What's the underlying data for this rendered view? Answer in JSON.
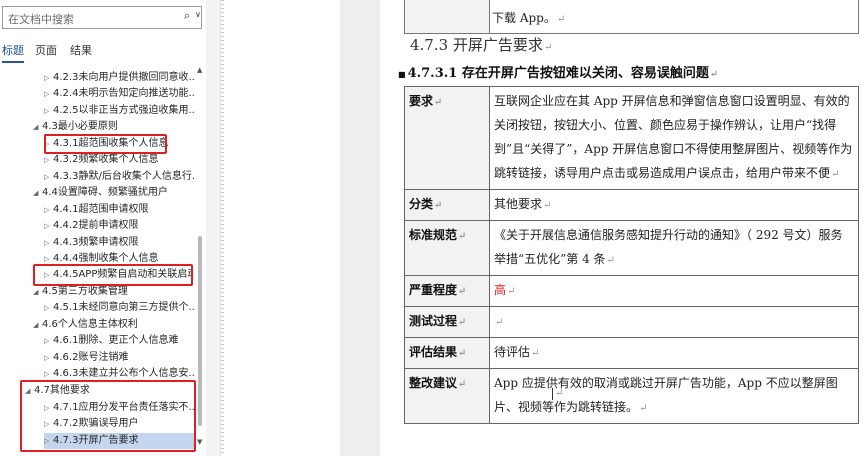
{
  "nav": {
    "search_placeholder": "在文档中搜索",
    "search_icon": "search-icon",
    "tabs": [
      "标题",
      "页面",
      "结果"
    ],
    "active_tab": "标题",
    "tree": [
      {
        "label": "4.2.3未向用户提供撤回同意收...",
        "level": 2,
        "arrow": "▷"
      },
      {
        "label": "4.2.4未明示告知定向推送功能...",
        "level": 2,
        "arrow": "▷"
      },
      {
        "label": "4.2.5以非正当方式强迫收集用...",
        "level": 2,
        "arrow": "▷"
      },
      {
        "label": "4.3最小必要原则",
        "level": 1,
        "arrow": "◢"
      },
      {
        "label": "4.3.1超范围收集个人信息",
        "level": 2,
        "arrow": "▷"
      },
      {
        "label": "4.3.2频繁收集个人信息",
        "level": 2,
        "arrow": "▷"
      },
      {
        "label": "4.3.3静默/后台收集个人信息行...",
        "level": 2,
        "arrow": "▷"
      },
      {
        "label": "4.4设置障碍、频繁骚扰用户",
        "level": 1,
        "arrow": "◢"
      },
      {
        "label": "4.4.1超范围申请权限",
        "level": 2,
        "arrow": "▷"
      },
      {
        "label": "4.4.2提前申请权限",
        "level": 2,
        "arrow": "▷"
      },
      {
        "label": "4.4.3频繁申请权限",
        "level": 2,
        "arrow": "▷"
      },
      {
        "label": "4.4.4强制收集个人信息",
        "level": 2,
        "arrow": "▷"
      },
      {
        "label": "4.4.5APP频繁自启动和关联启动",
        "level": 2,
        "arrow": "▷"
      },
      {
        "label": "4.5第三方收集管理",
        "level": 1,
        "arrow": "◢"
      },
      {
        "label": "4.5.1未经同意向第三方提供个...",
        "level": 2,
        "arrow": "▷"
      },
      {
        "label": "4.6个人信息主体权利",
        "level": 1,
        "arrow": "◢"
      },
      {
        "label": "4.6.1删除、更正个人信息难",
        "level": 2,
        "arrow": "▷"
      },
      {
        "label": "4.6.2账号注销难",
        "level": 2,
        "arrow": "▷"
      },
      {
        "label": "4.6.3未建立并公布个人信息安...",
        "level": 2,
        "arrow": "▷"
      },
      {
        "label": "4.7其他要求",
        "level": 1,
        "arrow": "◢"
      },
      {
        "label": "4.7.1应用分发平台责任落实不...",
        "level": 2,
        "arrow": "▷"
      },
      {
        "label": "4.7.2欺骗误导用户",
        "level": 2,
        "arrow": "▷"
      },
      {
        "label": "4.7.3开屏广告要求",
        "level": 2,
        "arrow": "▷",
        "selected": true
      }
    ]
  },
  "doc": {
    "top_cell_text": "下载 App。",
    "heading3": "4.7.3 开屏广告要求",
    "heading4": "4.7.3.1 存在开屏广告按钮难以关闭、容易误触问题",
    "table": [
      {
        "key": "要求",
        "value": "互联网企业应在其 App 开屏信息和弹窗信息窗口设置明显、有效的关闭按钮，按钮大小、位置、颜色应易于操作辨认，让用户“找得到”且“关得了”，App 开屏信息窗口不得使用整屏图片、视频等作为跳转链接，诱导用户点击或易造成用户误点击，给用户带来不便"
      },
      {
        "key": "分类",
        "value": "其他要求"
      },
      {
        "key": "标准规范",
        "value": "《关于开展信息通信服务感知提升行动的通知》（ 292 号文）服务举措“五优化”第 4 条"
      },
      {
        "key": "严重程度",
        "value": "高",
        "value_color": "#e02020"
      },
      {
        "key": "测试过程",
        "value": ""
      },
      {
        "key": "评估结果",
        "value": "待评估"
      },
      {
        "key": "整改建议",
        "value": "App 应提供有效的取消或跳过开屏广告功能，App 不应以整屏图片、视频等作为跳转链接。"
      }
    ],
    "para_mark": "↵"
  }
}
